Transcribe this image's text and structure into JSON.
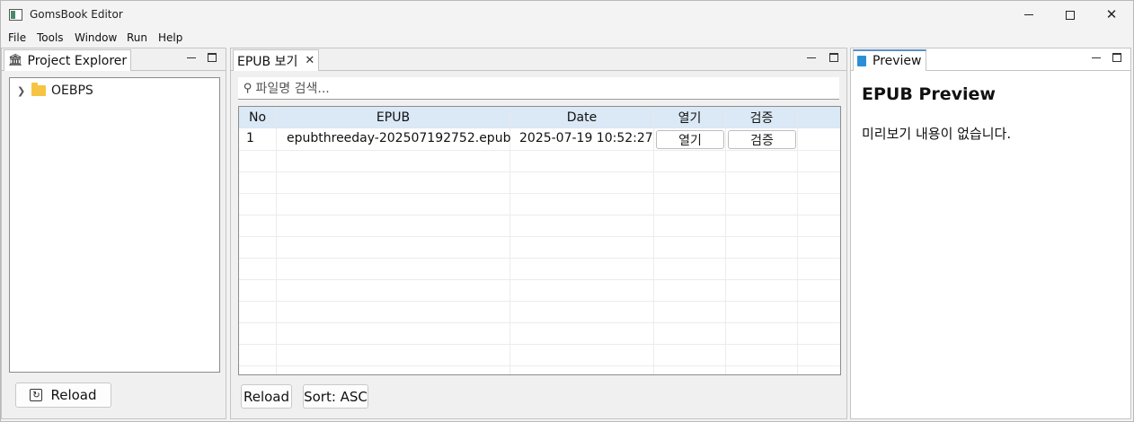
{
  "window": {
    "title": "GomsBook Editor"
  },
  "menu": [
    "File",
    "Tools",
    "Window",
    "Run",
    "Help"
  ],
  "project_explorer": {
    "tab_label": "Project Explorer",
    "tree": [
      {
        "label": "OEBPS",
        "expanded": false
      }
    ],
    "reload_label": "Reload"
  },
  "epub_view": {
    "tab_label": "EPUB 보기",
    "search_placeholder": "파일명 검색...",
    "columns": [
      "No",
      "EPUB",
      "Date",
      "열기",
      "검증"
    ],
    "rows": [
      {
        "no": "1",
        "epub": "epubthreeday-202507192752.epub",
        "date": "2025-07-19 10:52:27",
        "open": "열기",
        "verify": "검증"
      }
    ],
    "reload_label": "Reload",
    "sort_label": "Sort: ASC"
  },
  "preview": {
    "tab_label": "Preview",
    "heading": "EPUB Preview",
    "body": "미리보기 내용이 없습니다."
  },
  "colors": {
    "header_bg": "#dbe8f6",
    "folder": "#f6c343",
    "doc_icon": "#2b8fd6"
  }
}
